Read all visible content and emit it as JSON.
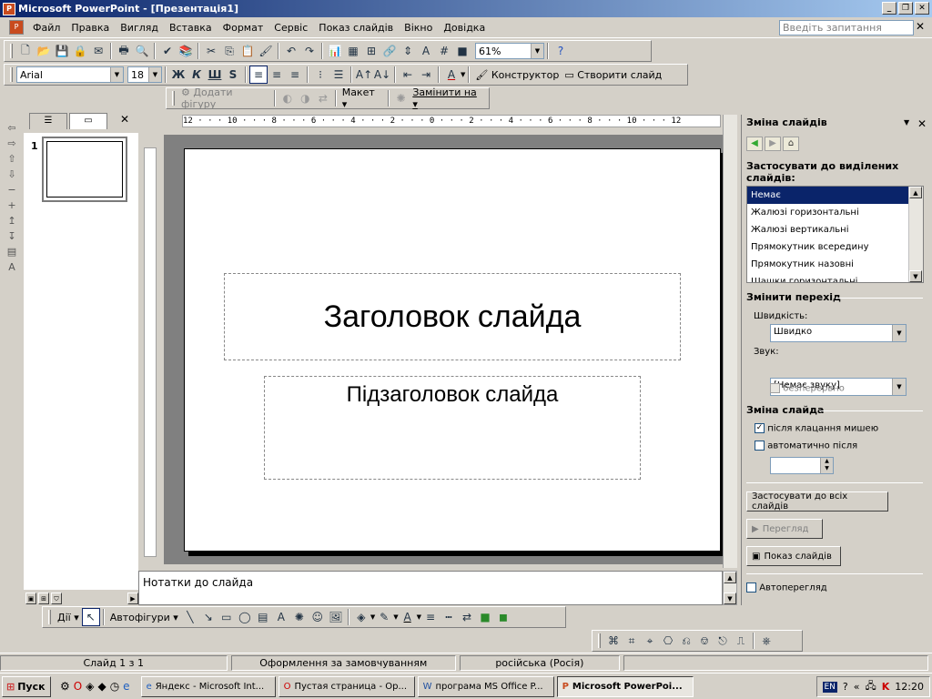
{
  "window": {
    "title": "Microsoft PowerPoint - [Презентація1]"
  },
  "menu": {
    "items": [
      "Файл",
      "Правка",
      "Вигляд",
      "Вставка",
      "Формат",
      "Сервіс",
      "Показ слайдів",
      "Вікно",
      "Довідка"
    ],
    "ask_placeholder": "Введіть запитання"
  },
  "toolbar": {
    "zoom": "61%",
    "font_name": "Arial",
    "font_size": "18",
    "bold": "Ж",
    "italic": "К",
    "underline": "Ш",
    "shadow": "S",
    "designer": "Конструктор",
    "new_slide": "Створити слайд",
    "add_shape": "Додати фігуру",
    "layout": "Макет",
    "replace": "Замінити на"
  },
  "thumbs": {
    "slide_number": "1"
  },
  "slide": {
    "title": "Заголовок слайда",
    "subtitle": "Підзаголовок слайда"
  },
  "ruler": {
    "h_labels": "12 · · · 10 · · · 8 · · · 6 · · · 4 · · · 2 · · · 0 · · · 2 · · · 4 · · · 6 · · · 8 · · · 10 · · · 12"
  },
  "notes": {
    "placeholder": "Нотатки до слайда"
  },
  "taskpane": {
    "title": "Зміна слайдів",
    "apply_label": "Застосувати до виділених слайдів:",
    "transitions": [
      "Немає",
      "Жалюзі горизонтальні",
      "Жалюзі вертикальні",
      "Прямокутник всередину",
      "Прямокутник назовні",
      "Шашки горизонтальні"
    ],
    "modify_section": "Змінити перехід",
    "speed_label": "Швидкість:",
    "speed_value": "Швидко",
    "sound_label": "Звук:",
    "sound_value": "[Немає звуку]",
    "loop_label": "безперервно",
    "advance_section": "Зміна слайда",
    "on_click_label": "після клацання мишею",
    "auto_label": "автоматично після",
    "apply_all_button": "Застосувати до всіх слайдів",
    "preview_button": "Перегляд",
    "slideshow_button": "Показ слайдів",
    "autopreview_label": "Автоперегляд"
  },
  "draw": {
    "actions": "Дії",
    "autoshapes": "Автофігури"
  },
  "status": {
    "slide": "Слайд 1 з 1",
    "design": "Оформлення за замовчуванням",
    "language": "російська (Росія)"
  },
  "taskbar": {
    "start": "Пуск",
    "buttons": [
      "Яндекс - Microsoft Int...",
      "Пустая страница - Op...",
      "програма MS Office P...",
      "Microsoft PowerPoi..."
    ],
    "lang": "EN",
    "clock": "12:20"
  }
}
